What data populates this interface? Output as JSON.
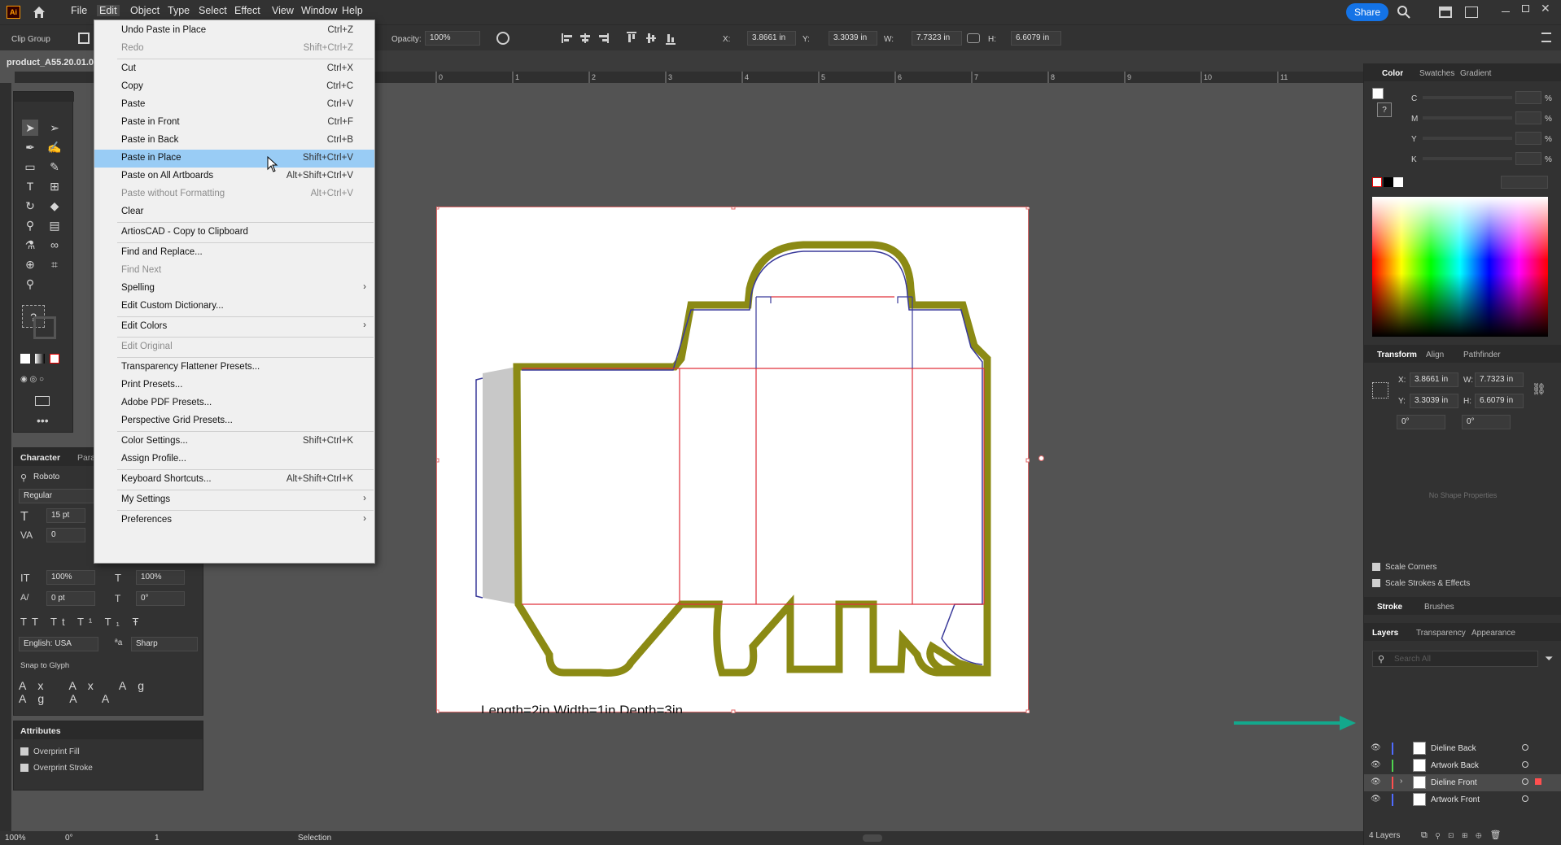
{
  "app": {
    "logo": "Ai",
    "share_label": "Share"
  },
  "menu": [
    "File",
    "Edit",
    "Object",
    "Type",
    "Select",
    "Effect",
    "View",
    "Window",
    "Help"
  ],
  "control_bar": {
    "selection_type": "Clip Group",
    "opacity_label": "Opacity:",
    "opacity_value": "100%",
    "x_label": "X:",
    "x_value": "3.8661 in",
    "y_label": "Y:",
    "y_value": "3.3039 in",
    "w_label": "W:",
    "w_value": "7.7323 in",
    "h_label": "H:",
    "h_value": "6.6079 in"
  },
  "document_tab": "product_A55.20.01.0",
  "edit_menu": [
    {
      "label": "Undo Paste in Place",
      "shortcut": "Ctrl+Z"
    },
    {
      "label": "Redo",
      "shortcut": "Shift+Ctrl+Z",
      "disabled": true
    },
    {
      "sep": true
    },
    {
      "label": "Cut",
      "shortcut": "Ctrl+X"
    },
    {
      "label": "Copy",
      "shortcut": "Ctrl+C"
    },
    {
      "label": "Paste",
      "shortcut": "Ctrl+V"
    },
    {
      "label": "Paste in Front",
      "shortcut": "Ctrl+F"
    },
    {
      "label": "Paste in Back",
      "shortcut": "Ctrl+B"
    },
    {
      "label": "Paste in Place",
      "shortcut": "Shift+Ctrl+V",
      "highlighted": true
    },
    {
      "label": "Paste on All Artboards",
      "shortcut": "Alt+Shift+Ctrl+V"
    },
    {
      "label": "Paste without Formatting",
      "shortcut": "Alt+Ctrl+V",
      "disabled": true
    },
    {
      "label": "Clear",
      "shortcut": ""
    },
    {
      "sep": true
    },
    {
      "label": "ArtiosCAD - Copy to Clipboard",
      "shortcut": ""
    },
    {
      "sep": true
    },
    {
      "label": "Find and Replace...",
      "shortcut": ""
    },
    {
      "label": "Find Next",
      "shortcut": "",
      "disabled": true
    },
    {
      "label": "Spelling",
      "shortcut": "",
      "submenu": true
    },
    {
      "label": "Edit Custom Dictionary...",
      "shortcut": ""
    },
    {
      "sep": true
    },
    {
      "label": "Edit Colors",
      "shortcut": "",
      "submenu": true
    },
    {
      "sep": true
    },
    {
      "label": "Edit Original",
      "shortcut": "",
      "disabled": true
    },
    {
      "sep": true
    },
    {
      "label": "Transparency Flattener Presets...",
      "shortcut": ""
    },
    {
      "label": "Print Presets...",
      "shortcut": ""
    },
    {
      "label": "Adobe PDF Presets...",
      "shortcut": ""
    },
    {
      "label": "Perspective Grid Presets...",
      "shortcut": ""
    },
    {
      "sep": true
    },
    {
      "label": "Color Settings...",
      "shortcut": "Shift+Ctrl+K"
    },
    {
      "label": "Assign Profile...",
      "shortcut": ""
    },
    {
      "sep": true
    },
    {
      "label": "Keyboard Shortcuts...",
      "shortcut": "Alt+Shift+Ctrl+K"
    },
    {
      "sep": true
    },
    {
      "label": "My Settings",
      "shortcut": "",
      "submenu": true
    },
    {
      "sep": true
    },
    {
      "label": "Preferences",
      "shortcut": "",
      "submenu": true
    }
  ],
  "character_panel": {
    "tab1": "Character",
    "tab2": "Para",
    "font": "Roboto",
    "style": "Regular",
    "size": "15 pt",
    "leading": "0",
    "vscale": "100%",
    "hscale": "100%",
    "tracking": "0 pt",
    "rotation": "0°",
    "language": "English: USA",
    "aa": "Sharp",
    "snap_label": "Snap to Glyph"
  },
  "attributes_panel": {
    "title": "Attributes",
    "overprint_fill": "Overprint Fill",
    "overprint_stroke": "Overprint Stroke"
  },
  "color_panel": {
    "tabs": [
      "Color",
      "Swatches",
      "Gradient"
    ],
    "channels": [
      "C",
      "M",
      "Y",
      "K"
    ],
    "units": "%"
  },
  "transform_panel": {
    "tabs": [
      "Transform",
      "Align",
      "Pathfinder"
    ],
    "x_label": "X:",
    "x": "3.8661 in",
    "w_label": "W:",
    "w": "7.7323 in",
    "y_label": "Y:",
    "y": "3.3039 in",
    "h_label": "H:",
    "h": "6.6079 in",
    "angle": "0°",
    "shear": "0°",
    "no_shape": "No Shape Properties",
    "scale_corners": "Scale Corners",
    "scale_strokes": "Scale Strokes & Effects"
  },
  "stroke_tabs": [
    "Stroke",
    "Brushes"
  ],
  "layers_panel": {
    "tabs": [
      "Layers",
      "Transparency",
      "Appearance"
    ],
    "search_placeholder": "Search All",
    "layers": [
      {
        "name": "Dieline Back",
        "color": "#4f6bff",
        "selected": false
      },
      {
        "name": "Artwork Back",
        "color": "#4fd44f",
        "selected": false
      },
      {
        "name": "Dieline Front",
        "color": "#ff4f4f",
        "selected": true
      },
      {
        "name": "Artwork Front",
        "color": "#4f6bff",
        "selected": false
      }
    ],
    "count": "4 Layers"
  },
  "artboard": {
    "caption": "Length=2in Width=1in Depth=3in"
  },
  "ruler_ticks": [
    "0",
    "1",
    "2",
    "3",
    "4",
    "5",
    "6",
    "7",
    "8",
    "9",
    "10",
    "11"
  ],
  "status": {
    "zoom": "100%",
    "rotation": "0°",
    "page": "1",
    "tool": "Selection"
  },
  "colors": {
    "accent": "#1473e6",
    "dieline_olive": "#8b8a14",
    "highlight": "#99ccf5",
    "arrow": "#13a88c"
  }
}
